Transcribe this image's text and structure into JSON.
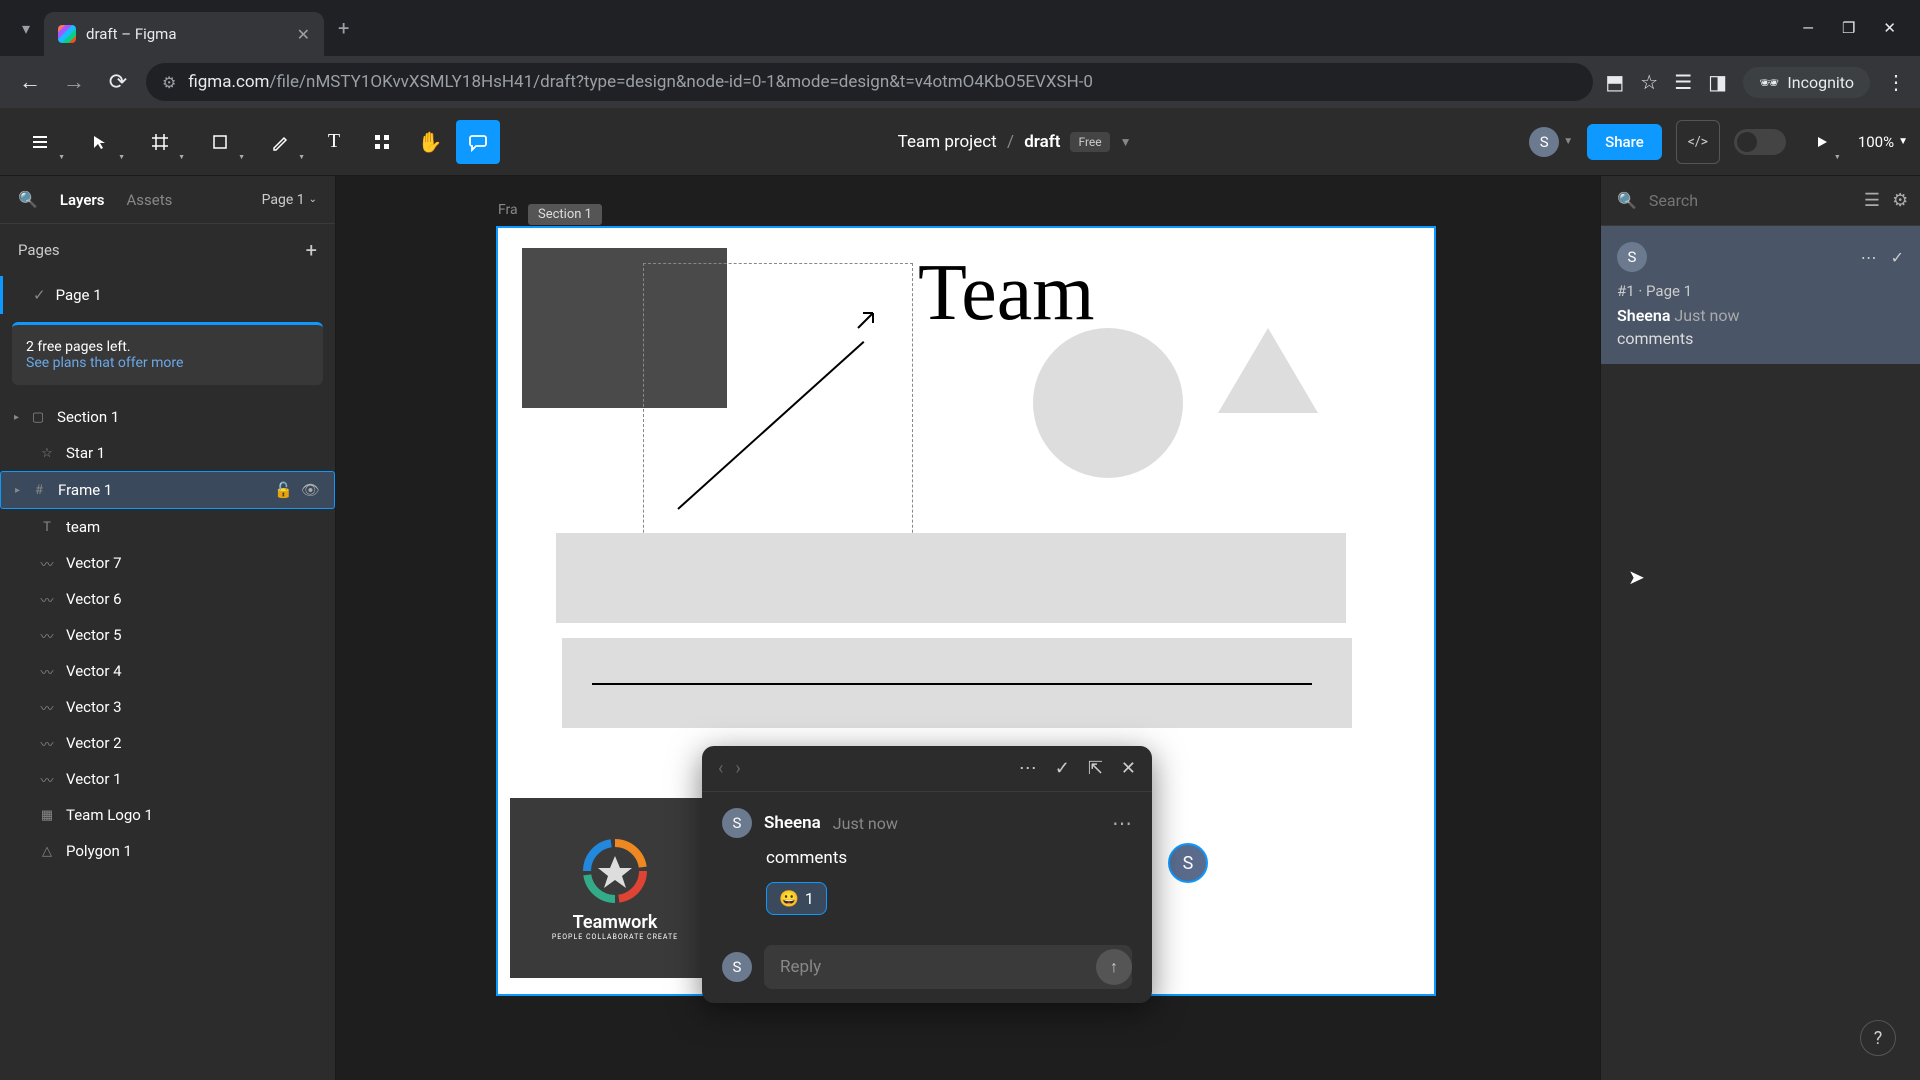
{
  "browser": {
    "tab_title": "draft – Figma",
    "url_domain": "figma.com",
    "url_path": "/file/nMSTY1OKvvXSMLY18HsH41/draft?type=design&node-id=0-1&mode=design&t=v4otmO4KbO5EVXSH-0",
    "incognito_label": "Incognito"
  },
  "figma": {
    "project": "Team project",
    "file": "draft",
    "plan_badge": "Free",
    "zoom": "100%",
    "user_initial": "S",
    "share_label": "Share"
  },
  "left_panel": {
    "tabs": {
      "layers": "Layers",
      "assets": "Assets"
    },
    "page_selector": "Page 1",
    "pages_header": "Pages",
    "current_page": "Page 1",
    "free_notice_line1": "2 free pages left.",
    "free_notice_link": "See plans that offer more",
    "layers": [
      {
        "name": "Section 1",
        "icon": "section",
        "indent": 0
      },
      {
        "name": "Star 1",
        "icon": "star",
        "indent": 1
      },
      {
        "name": "Frame 1",
        "icon": "frame",
        "indent": 0,
        "selected": true
      },
      {
        "name": "team",
        "icon": "text",
        "indent": 1
      },
      {
        "name": "Vector 7",
        "icon": "vector",
        "indent": 1
      },
      {
        "name": "Vector 6",
        "icon": "vector",
        "indent": 1
      },
      {
        "name": "Vector 5",
        "icon": "vector",
        "indent": 1
      },
      {
        "name": "Vector 4",
        "icon": "vector",
        "indent": 1
      },
      {
        "name": "Vector 3",
        "icon": "vector",
        "indent": 1
      },
      {
        "name": "Vector 2",
        "icon": "vector",
        "indent": 1
      },
      {
        "name": "Vector 1",
        "icon": "vector",
        "indent": 1
      },
      {
        "name": "Team Logo 1",
        "icon": "image",
        "indent": 1
      },
      {
        "name": "Polygon 1",
        "icon": "polygon",
        "indent": 1
      }
    ]
  },
  "canvas": {
    "frame_label": "Fra",
    "section_tag": "Section 1",
    "team_text": "Team",
    "teamwork_label": "Teamwork",
    "teamwork_sublabel": "PEOPLE COLLABORATE CREATE",
    "collab_initial": "S"
  },
  "comment_popup": {
    "author": "Sheena",
    "time": "Just now",
    "text": "comments",
    "reaction_emoji": "😀",
    "reaction_count": "1",
    "reply_placeholder": "Reply",
    "author_initial": "S"
  },
  "right_panel": {
    "search_placeholder": "Search",
    "comment": {
      "author_initial": "S",
      "ref": "#1 · Page 1",
      "author": "Sheena",
      "time": "Just now",
      "text": "comments"
    }
  }
}
